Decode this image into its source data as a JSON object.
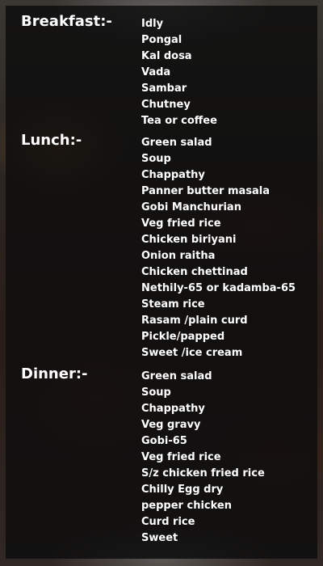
{
  "menu": {
    "breakfast": {
      "title": "Breakfast:-",
      "items": [
        "Idly",
        "Pongal",
        "Kal dosa",
        "Vada",
        "Sambar",
        "Chutney",
        "Tea or coffee"
      ]
    },
    "lunch": {
      "title": "Lunch:-",
      "items": [
        "Green salad",
        "Soup",
        "Chappathy",
        "Panner butter masala",
        "Gobi Manchurian",
        "Veg fried rice",
        "Chicken biriyani",
        "Onion raitha",
        "Chicken chettinad",
        "Nethily-65 or kadamba-65",
        "Steam rice",
        "Rasam /plain curd",
        "Pickle/papped",
        "Sweet /ice cream"
      ]
    },
    "dinner": {
      "title": "Dinner:-",
      "items": [
        "Green salad",
        "Soup",
        "Chappathy",
        "Veg gravy",
        "Gobi-65",
        "Veg fried rice",
        "S/z chicken fried rice",
        "Chilly Egg dry",
        "pepper chicken",
        "Curd rice",
        "Sweet"
      ]
    }
  }
}
